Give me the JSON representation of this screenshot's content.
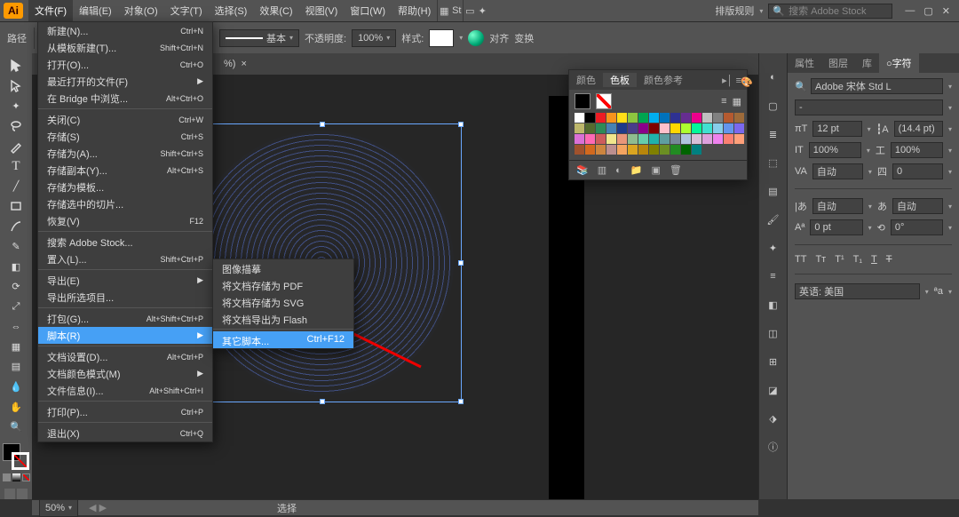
{
  "app_icon": "Ai",
  "menubar": [
    "文件(F)",
    "编辑(E)",
    "对象(O)",
    "文字(T)",
    "选择(S)",
    "效果(C)",
    "视图(V)",
    "窗口(W)",
    "帮助(H)"
  ],
  "top_right": {
    "layout_label": "排版规则",
    "search_placeholder": "搜索 Adobe Stock"
  },
  "controlbar": {
    "stroke_label": "基本",
    "opacity_label": "不透明度:",
    "opacity_value": "100%",
    "style_label": "样式:",
    "align_label": "对齐",
    "transform_label": "变换"
  },
  "doc_tab": {
    "suffix": "%)",
    "close": "×"
  },
  "file_menu": [
    {
      "label": "新建(N)...",
      "shortcut": "Ctrl+N"
    },
    {
      "label": "从模板新建(T)...",
      "shortcut": "Shift+Ctrl+N"
    },
    {
      "label": "打开(O)...",
      "shortcut": "Ctrl+O"
    },
    {
      "label": "最近打开的文件(F)",
      "arrow": true
    },
    {
      "label": "在 Bridge 中浏览...",
      "shortcut": "Alt+Ctrl+O"
    },
    {
      "div": true
    },
    {
      "label": "关闭(C)",
      "shortcut": "Ctrl+W"
    },
    {
      "label": "存储(S)",
      "shortcut": "Ctrl+S"
    },
    {
      "label": "存储为(A)...",
      "shortcut": "Shift+Ctrl+S"
    },
    {
      "label": "存储副本(Y)...",
      "shortcut": "Alt+Ctrl+S"
    },
    {
      "label": "存储为模板..."
    },
    {
      "label": "存储选中的切片..."
    },
    {
      "label": "恢复(V)",
      "shortcut": "F12"
    },
    {
      "div": true
    },
    {
      "label": "搜索 Adobe Stock..."
    },
    {
      "label": "置入(L)...",
      "shortcut": "Shift+Ctrl+P"
    },
    {
      "div": true
    },
    {
      "label": "导出(E)",
      "arrow": true
    },
    {
      "label": "导出所选项目..."
    },
    {
      "div": true
    },
    {
      "label": "打包(G)...",
      "shortcut": "Alt+Shift+Ctrl+P"
    },
    {
      "label": "脚本(R)",
      "arrow": true,
      "highlight": true
    },
    {
      "div": true
    },
    {
      "label": "文档设置(D)...",
      "shortcut": "Alt+Ctrl+P"
    },
    {
      "label": "文档颜色模式(M)",
      "arrow": true
    },
    {
      "label": "文件信息(I)...",
      "shortcut": "Alt+Shift+Ctrl+I"
    },
    {
      "div": true
    },
    {
      "label": "打印(P)...",
      "shortcut": "Ctrl+P"
    },
    {
      "div": true
    },
    {
      "label": "退出(X)",
      "shortcut": "Ctrl+Q"
    }
  ],
  "script_submenu": [
    {
      "label": "图像描摹"
    },
    {
      "label": "将文档存储为 PDF"
    },
    {
      "label": "将文档存储为 SVG"
    },
    {
      "label": "将文档导出为 Flash"
    },
    {
      "div": true
    },
    {
      "label": "其它脚本...",
      "shortcut": "Ctrl+F12",
      "highlight": true
    }
  ],
  "swatches_panel": {
    "tabs": [
      "颜色",
      "色板",
      "颜色参考"
    ],
    "active_tab": "色板",
    "colors": [
      "#ffffff",
      "#000000",
      "#ed1c24",
      "#f7941d",
      "#ffde17",
      "#8dc63f",
      "#00a651",
      "#00aeef",
      "#0072bc",
      "#2e3192",
      "#662d91",
      "#ec008c",
      "#c0c0c0",
      "#808080",
      "#b55a30",
      "#9e6b3a",
      "#bdb76b",
      "#556b2f",
      "#2e8b57",
      "#4682b4",
      "#1e3a8a",
      "#483d8b",
      "#8b008b",
      "#800000",
      "#ffc0cb",
      "#ffd700",
      "#adff2f",
      "#00fa9a",
      "#40e0d0",
      "#87ceeb",
      "#6495ed",
      "#7b68ee",
      "#da70d6",
      "#ff69b4",
      "#cd5c5c",
      "#f0e68c",
      "#e9967a",
      "#8fbc8f",
      "#66cdaa",
      "#20b2aa",
      "#5f9ea0",
      "#778899",
      "#b0c4de",
      "#d8bfd8",
      "#dda0dd",
      "#ee82ee",
      "#fa8072",
      "#ffa07a",
      "#a0522d",
      "#d2691e",
      "#cd853f",
      "#bc8f8f",
      "#f4a460",
      "#daa520",
      "#b8860b",
      "#808000",
      "#6b8e23",
      "#228b22",
      "#006400",
      "#008080"
    ]
  },
  "right_panel": {
    "tabs": [
      "属性",
      "图层",
      "库",
      "○字符"
    ],
    "active": "○字符",
    "font": "Adobe 宋体 Std L",
    "style": "-",
    "size": "12 pt",
    "leading": "(14.4 pt)",
    "tracking": "自动",
    "kerning": "0",
    "vscale": "100%",
    "hscale": "100%",
    "baseline": "0 pt",
    "rotate": "0°",
    "autokern": "自动",
    "autokern2": "自动",
    "lang": "英语: 美国"
  },
  "statusbar": {
    "zoom": "50%",
    "info": "选择"
  }
}
